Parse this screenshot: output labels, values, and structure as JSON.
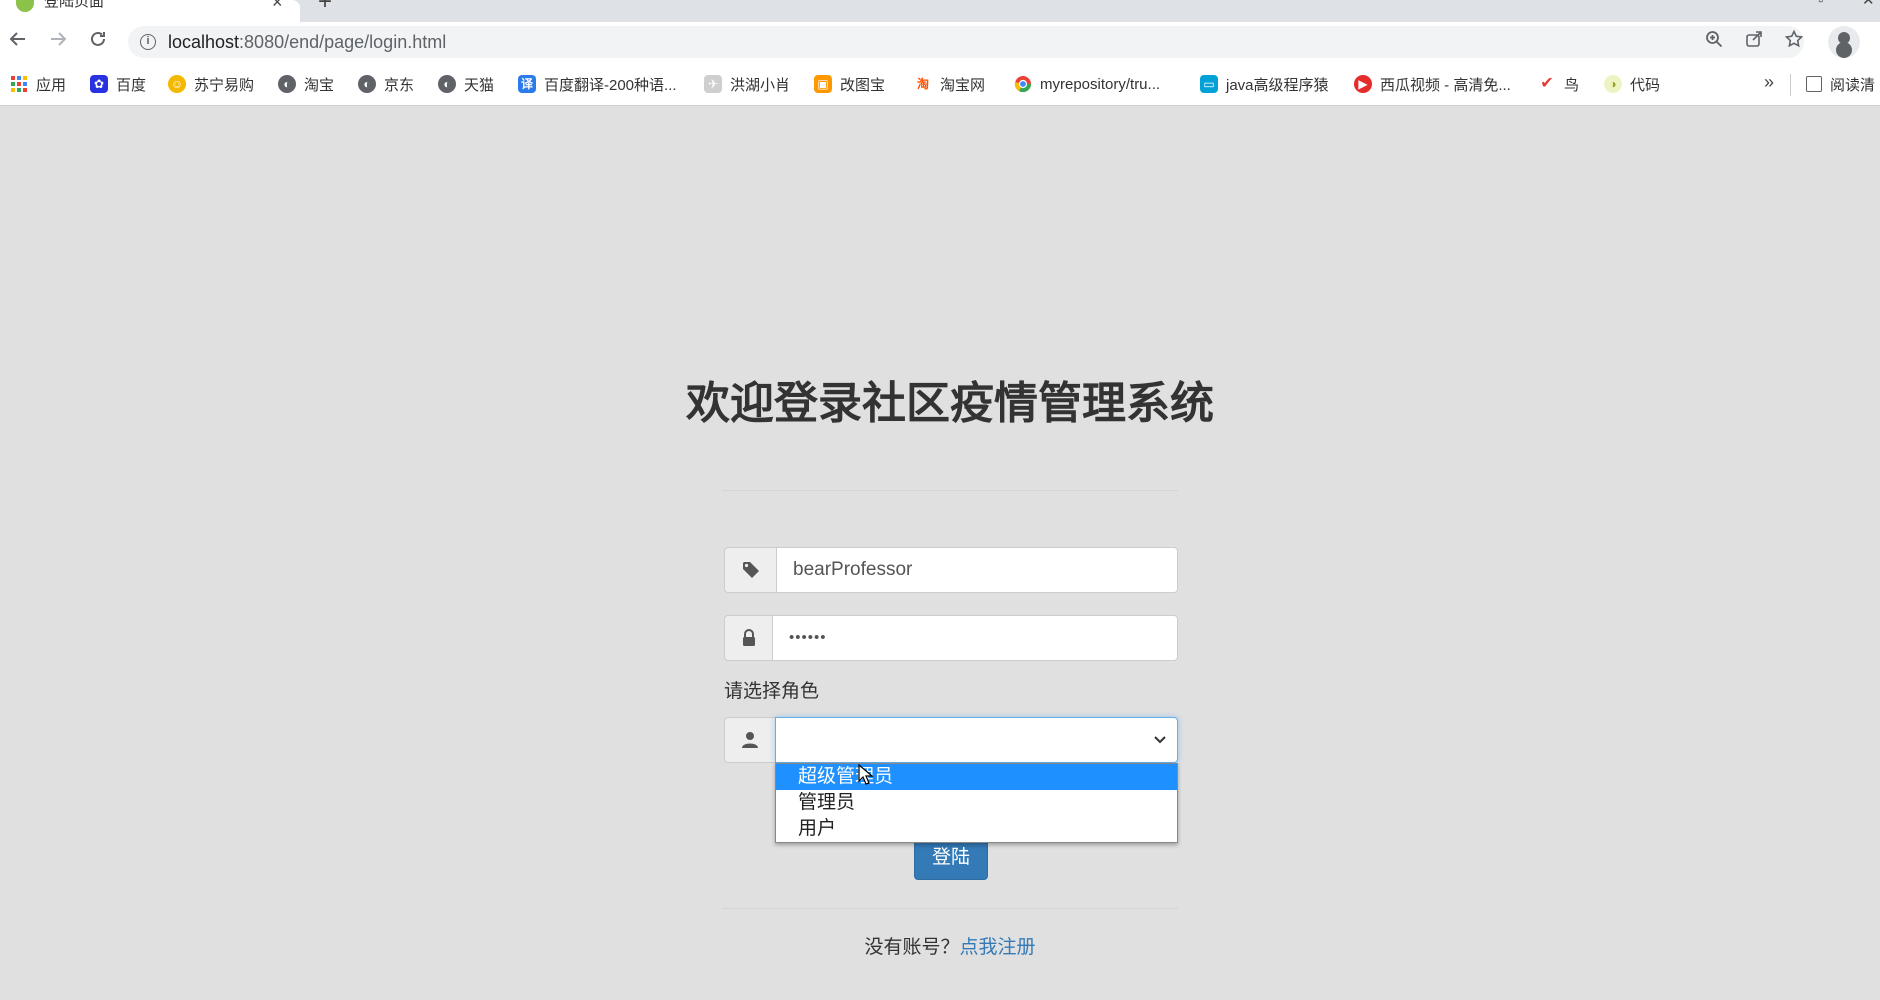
{
  "browser": {
    "tab_title": "登陆页面",
    "tab_close": "×",
    "new_tab": "+",
    "url_host": "localhost",
    "url_rest": ":8080/end/page/login.html",
    "bookmarks": [
      {
        "label": "应用",
        "icon": "apps-grid-icon",
        "color": "#4285f4"
      },
      {
        "label": "百度",
        "icon": "baidu-paw-icon",
        "color": "#2932e1"
      },
      {
        "label": "苏宁易购",
        "icon": "suning-lion-icon",
        "color": "#f5b800"
      },
      {
        "label": "淘宝",
        "icon": "globe-icon",
        "color": "#5f6368"
      },
      {
        "label": "京东",
        "icon": "globe-icon",
        "color": "#5f6368"
      },
      {
        "label": "天猫",
        "icon": "globe-icon",
        "color": "#5f6368"
      },
      {
        "label": "百度翻译-200种语...",
        "icon": "translate-icon",
        "color": "#2b7bea"
      },
      {
        "label": "洪湖小肖",
        "icon": "bird-icon",
        "color": "#888888"
      },
      {
        "label": "改图宝",
        "icon": "image-edit-icon",
        "color": "#ff9800"
      },
      {
        "label": "淘宝网",
        "icon": "taobao-icon",
        "color": "#ff5000"
      },
      {
        "label": "myrepository/tru...",
        "icon": "chrome-icon",
        "color": "#34a853"
      },
      {
        "label": "java高级程序猿",
        "icon": "bilibili-tv-icon",
        "color": "#00a1d6"
      },
      {
        "label": "西瓜视频 - 高清免...",
        "icon": "xigua-play-icon",
        "color": "#e62b2b"
      },
      {
        "label": "鸟",
        "icon": "bird-red-icon",
        "color": "#e53935"
      },
      {
        "label": "代码",
        "icon": "code-icon",
        "color": "#cddc39"
      }
    ],
    "more": "»",
    "reading_list": "阅读清"
  },
  "login": {
    "title": "欢迎登录社区疫情管理系统",
    "username_value": "bearProfessor",
    "password_mask": "••••••",
    "role_label": "请选择角色",
    "role_options": [
      "超级管理员",
      "管理员",
      "用户"
    ],
    "selected_option_index": 0,
    "submit_label": "登陆",
    "signup_prompt": "没有账号？",
    "signup_link": "点我注册"
  },
  "colors": {
    "page_bg": "#e0e0e0",
    "primary": "#337ab7",
    "dropdown_highlight": "#1e90ff",
    "focus_border": "#66afe9"
  }
}
